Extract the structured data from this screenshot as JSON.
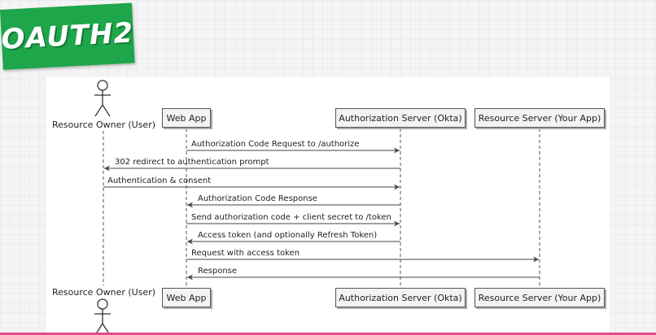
{
  "logo": {
    "text": "OAUTH2"
  },
  "participants": [
    {
      "name": "Resource Owner (User)",
      "kind": "actor"
    },
    {
      "name": "Web App",
      "kind": "box"
    },
    {
      "name": "Authorization Server (Okta)",
      "kind": "box"
    },
    {
      "name": "Resource Server (Your App)",
      "kind": "box"
    }
  ],
  "messages": [
    {
      "from": 1,
      "to": 2,
      "label": "Authorization Code Request to /authorize"
    },
    {
      "from": 2,
      "to": 0,
      "label": "302 redirect to authentication prompt"
    },
    {
      "from": 0,
      "to": 2,
      "label": "Authentication & consent"
    },
    {
      "from": 2,
      "to": 1,
      "label": "Authorization Code Response"
    },
    {
      "from": 1,
      "to": 2,
      "label": "Send authorization code + client secret to /token"
    },
    {
      "from": 2,
      "to": 1,
      "label": "Access token (and optionally Refresh Token)"
    },
    {
      "from": 1,
      "to": 3,
      "label": "Request with access token"
    },
    {
      "from": 3,
      "to": 1,
      "label": "Response"
    }
  ],
  "colors": {
    "logo_bg": "#1da64a",
    "accent_bar": "#e8488a",
    "participant_fill": "#f3f3f3",
    "line": "#555555"
  }
}
